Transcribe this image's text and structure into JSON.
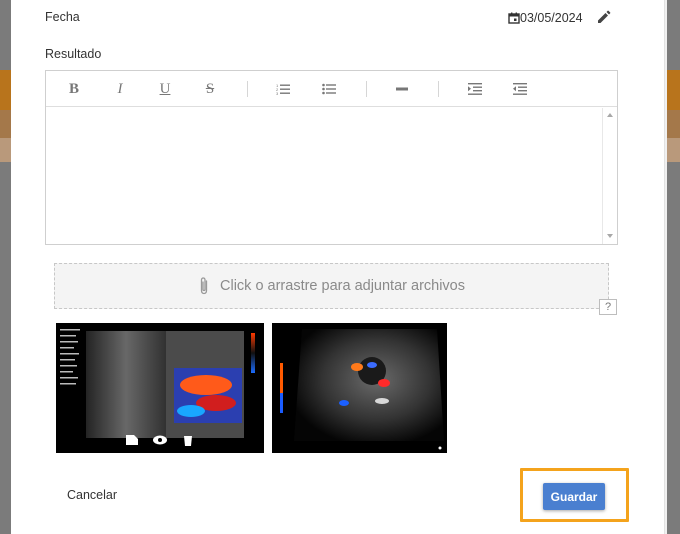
{
  "form": {
    "date_label": "Fecha",
    "date_value": "03/05/2024",
    "result_label": "Resultado"
  },
  "editor": {
    "toolbar": {
      "bold": "B",
      "italic": "I",
      "underline": "U",
      "strikethrough": "S"
    },
    "content": ""
  },
  "attachments": {
    "dropzone_text": "Click o arrastre para adjuntar archivos",
    "help_label": "?",
    "images": [
      {
        "name": "ultrasound-image-1",
        "icons": [
          "document-icon",
          "eye-icon",
          "trash-icon"
        ]
      },
      {
        "name": "ultrasound-image-2"
      }
    ]
  },
  "actions": {
    "cancel_label": "Cancelar",
    "save_label": "Guardar"
  },
  "colors": {
    "save_button": "#4a7fd0",
    "highlight_outline": "#f4a31c"
  }
}
